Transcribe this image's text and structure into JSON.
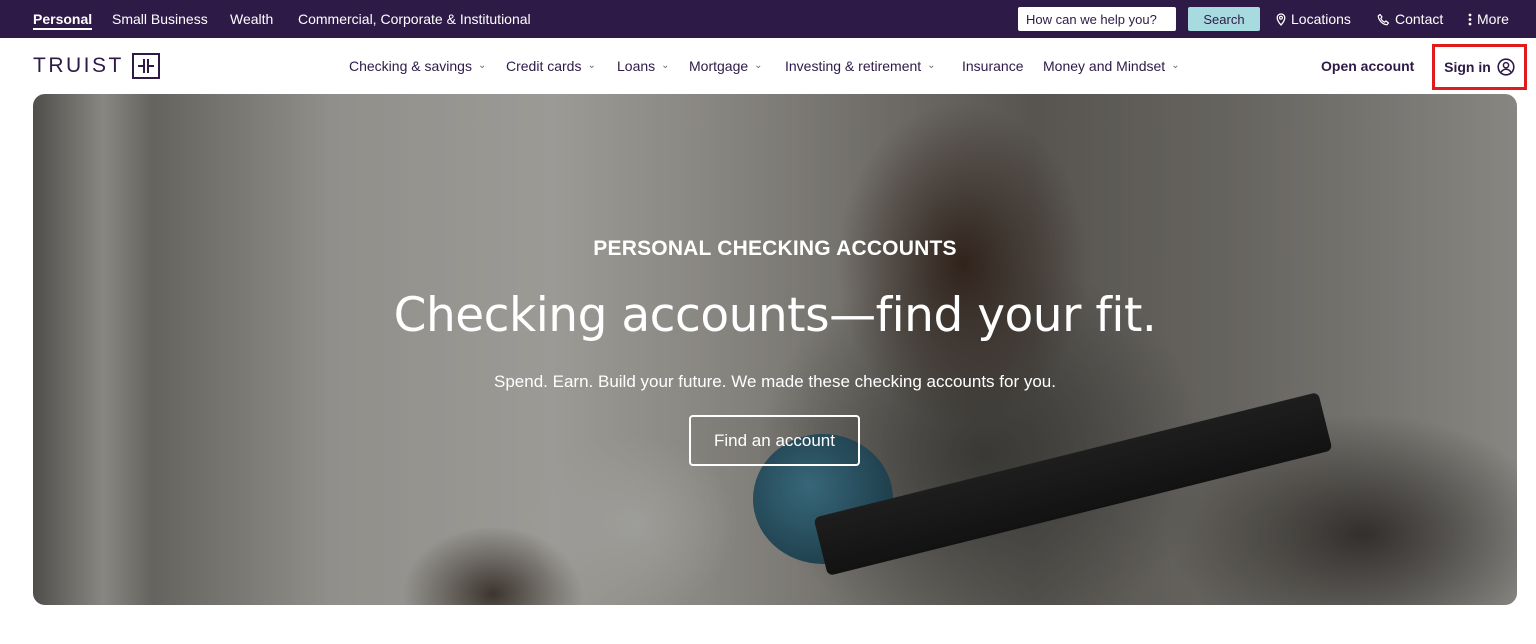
{
  "utility_bar": {
    "segments": [
      {
        "label": "Personal",
        "active": true
      },
      {
        "label": "Small Business",
        "active": false
      },
      {
        "label": "Wealth",
        "active": false
      },
      {
        "label": "Commercial, Corporate & Institutional",
        "active": false
      }
    ],
    "search_placeholder": "How can we help you?",
    "search_button": "Search",
    "locations": "Locations",
    "contact": "Contact",
    "more": "More"
  },
  "header": {
    "logo_text": "TRUIST",
    "nav": [
      {
        "label": "Checking & savings",
        "dropdown": true
      },
      {
        "label": "Credit cards",
        "dropdown": true
      },
      {
        "label": "Loans",
        "dropdown": true
      },
      {
        "label": "Mortgage",
        "dropdown": true
      },
      {
        "label": "Investing & retirement",
        "dropdown": true
      },
      {
        "label": "Insurance",
        "dropdown": false
      },
      {
        "label": "Money and Mindset",
        "dropdown": true
      }
    ],
    "open_account": "Open account",
    "sign_in": "Sign in"
  },
  "hero": {
    "eyebrow": "PERSONAL CHECKING ACCOUNTS",
    "headline": "Checking accounts—find your fit.",
    "subtext": "Spend. Earn. Build your future. We made these checking accounts for you.",
    "cta": "Find an account"
  },
  "colors": {
    "brand_purple": "#2e1a47",
    "search_button": "#a8dbe0",
    "annotation_red": "#e01b1b"
  },
  "icons": {
    "locations": "location-pin-icon",
    "contact": "phone-icon",
    "more": "vertical-dots-icon",
    "sign_in": "user-circle-icon",
    "nav_dropdown": "chevron-down-icon"
  }
}
